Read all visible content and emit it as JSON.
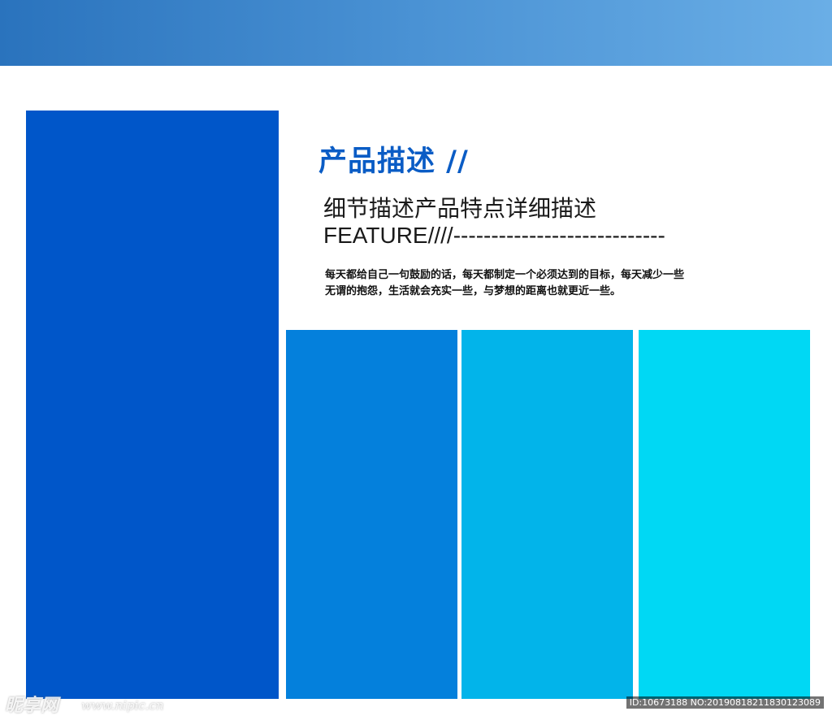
{
  "header": {
    "title": "产品描述 //",
    "subtitle": "细节描述产品特点详细描述",
    "feature_line": "FEATURE////----------------------------"
  },
  "body": {
    "line1": "每天都给自己一句鼓励的话，每天都制定一个必须达到的目标，每天减少一些",
    "line2": "无谓的抱怨，生活就会充实一些，与梦想的距离也就更近一些。"
  },
  "watermark": {
    "logo": "昵享网",
    "url": "www.nipic.cn",
    "id": "ID:10673188 NO:20190818211830123089"
  },
  "colors": {
    "banner_start": "#2a73bd",
    "banner_end": "#6aaee6",
    "panel_main": "#0056c9",
    "panel_1": "#0480dc",
    "panel_2": "#02b4ea",
    "panel_3": "#00d8f4",
    "title": "#0a5cc5"
  }
}
